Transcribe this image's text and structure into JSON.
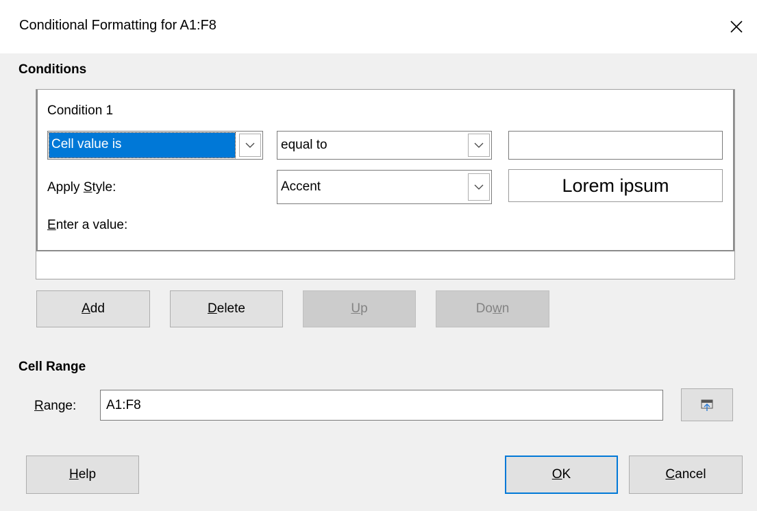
{
  "window": {
    "title": "Conditional Formatting for A1:F8",
    "close_glyph": "✕"
  },
  "conditions": {
    "heading": "Conditions",
    "entry": {
      "label": "Condition 1",
      "type_combo": "Cell value is",
      "operator_combo": "equal to",
      "value_input": "",
      "apply_style_label_pre": "Apply ",
      "apply_style_label_key": "S",
      "apply_style_label_post": "tyle:",
      "style_combo": "Accent",
      "preview_text": "Lorem ipsum",
      "enter_value_key": "E",
      "enter_value_post": "nter a value:"
    }
  },
  "actions": {
    "add_key": "A",
    "add_post": "dd",
    "delete_key": "D",
    "delete_post": "elete",
    "up_key": "U",
    "up_post": "p",
    "down_pre": "Do",
    "down_key": "w",
    "down_post": "n"
  },
  "cell_range": {
    "heading": "Cell Range",
    "label_key": "R",
    "label_post": "ange:",
    "value": "A1:F8"
  },
  "footer": {
    "help_key": "H",
    "help_post": "elp",
    "ok_key": "O",
    "ok_post": "K",
    "cancel_key": "C",
    "cancel_post": "ancel"
  },
  "colors": {
    "accent": "#0078d7",
    "dialog_bg": "#f0f0f0"
  }
}
